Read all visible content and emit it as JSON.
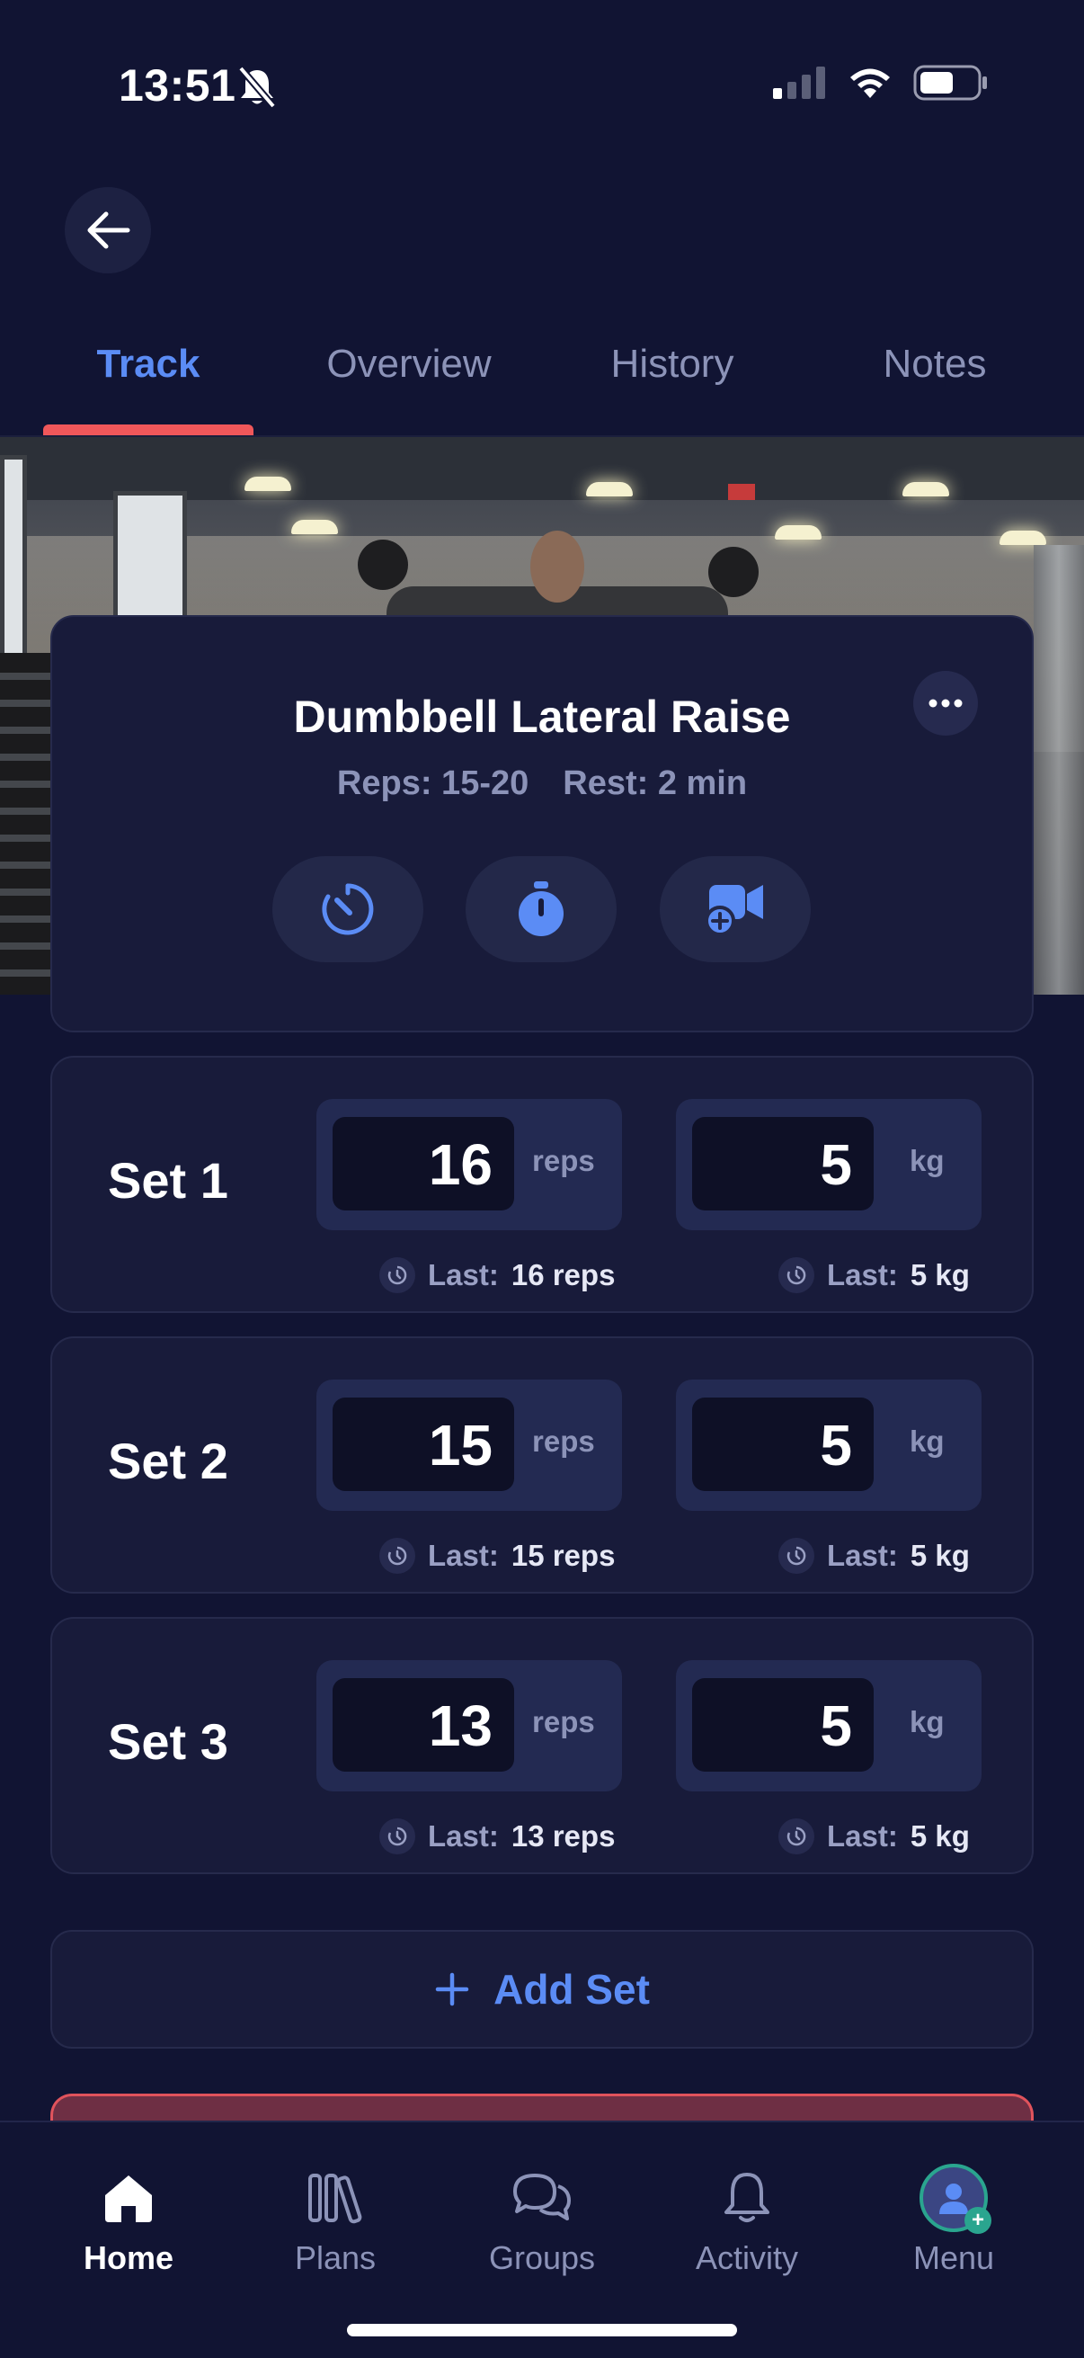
{
  "status_bar": {
    "time": "13:51"
  },
  "tabs": [
    {
      "label": "Track",
      "active": true
    },
    {
      "label": "Overview",
      "active": false
    },
    {
      "label": "History",
      "active": false
    },
    {
      "label": "Notes",
      "active": false
    }
  ],
  "exercise": {
    "title": "Dumbbell Lateral Raise",
    "reps": "Reps: 15-20",
    "rest": "Rest: 2 min",
    "actions": [
      "rest-timer-icon",
      "stopwatch-icon",
      "add-video-icon"
    ]
  },
  "sets": [
    {
      "label": "Set 1",
      "reps": "16",
      "reps_unit": "reps",
      "weight": "5",
      "weight_unit": "kg",
      "last_label": "Last:",
      "last_reps": "16 reps",
      "last_weight": "5 kg"
    },
    {
      "label": "Set 2",
      "reps": "15",
      "reps_unit": "reps",
      "weight": "5",
      "weight_unit": "kg",
      "last_label": "Last:",
      "last_reps": "15 reps",
      "last_weight": "5 kg"
    },
    {
      "label": "Set 3",
      "reps": "13",
      "reps_unit": "reps",
      "weight": "5",
      "weight_unit": "kg",
      "last_label": "Last:",
      "last_reps": "13 reps",
      "last_weight": "5 kg"
    }
  ],
  "add_set_label": "Add Set",
  "bottom_nav": [
    {
      "label": "Home",
      "icon": "home-icon",
      "active": true
    },
    {
      "label": "Plans",
      "icon": "plans-icon",
      "active": false
    },
    {
      "label": "Groups",
      "icon": "groups-icon",
      "active": false
    },
    {
      "label": "Activity",
      "icon": "bell-icon",
      "active": false
    },
    {
      "label": "Menu",
      "icon": "avatar-icon",
      "active": false
    }
  ],
  "colors": {
    "background": "#111433",
    "card": "#181b3a",
    "accent": "#5b8cf5",
    "tab_indicator": "#f0575a",
    "muted_text": "#8c93b8"
  }
}
